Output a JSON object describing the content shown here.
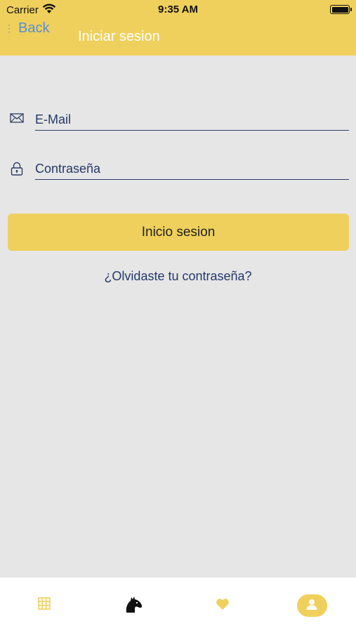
{
  "status_bar": {
    "carrier": "Carrier",
    "time": "9:35 AM"
  },
  "nav": {
    "back_label": "Back",
    "title": "Iniciar sesion"
  },
  "form": {
    "email_placeholder": "E-Mail",
    "password_placeholder": "Contraseña",
    "login_button": "Inicio sesion",
    "forgot_link": "¿Olvidaste tu contraseña?"
  },
  "tabbar": {
    "tabs": [
      {
        "icon": "grid-icon"
      },
      {
        "icon": "horse-icon"
      },
      {
        "icon": "heart-icon"
      },
      {
        "icon": "user-icon",
        "selected": true
      }
    ]
  },
  "colors": {
    "accent": "#efd05c",
    "text_navy": "#24386a",
    "back_blue": "#5a8ed6",
    "background": "#e6e6e6"
  }
}
